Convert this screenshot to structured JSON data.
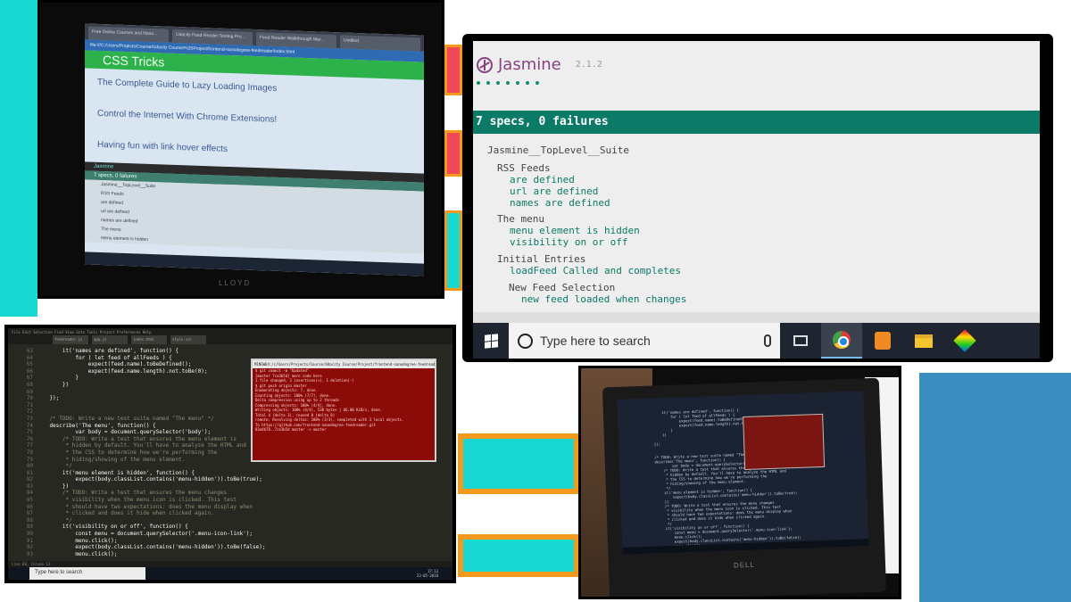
{
  "collage": {
    "accent_cyan": "#19d8d2",
    "accent_orange": "#f39a1e",
    "accent_red": "#f0475a",
    "accent_blue": "#3a8ec0"
  },
  "photo_monitor": {
    "tabs": [
      "Free Online Courses and Nano...",
      "Udacity Feed Reader Testing Pro...",
      "Feed Reader Walkthrough Mar...",
      "Untitled"
    ],
    "url": "file:///C:/Users/Projects/Course/Udacity Course/%20Project/frontend-nanodegree-feedreader/index.html",
    "header": "CSS Tricks",
    "links": [
      "The Complete Guide to Lazy Loading Images",
      "Control the Internet With Chrome Extensions!",
      "Having fun with link hover effects"
    ],
    "jasmine_label": "Jasmine",
    "jasmine_result": "7 specs, 0 failures",
    "specs": [
      "Jasmine__TopLevel__Suite",
      "RSS Feeds",
      "are defined",
      "url are defined",
      "names are defined",
      "The menu",
      "menu element is hidden"
    ],
    "bezel": "LLOYD"
  },
  "jasmine": {
    "name": "Jasmine",
    "version": "2.1.2",
    "dots": 7,
    "result": "7 specs, 0 failures",
    "top_suite": "Jasmine__TopLevel__Suite",
    "suites": [
      {
        "title": "RSS Feeds",
        "specs": [
          "are defined",
          "url are defined",
          "names are defined"
        ]
      },
      {
        "title": "The menu",
        "specs": [
          "menu element is hidden",
          "visibility on or off"
        ]
      },
      {
        "title": "Initial Entries",
        "specs": [
          "loadFeed Called and completes"
        ]
      },
      {
        "title": "New Feed Selection",
        "specs": [
          "new feed loaded when changes"
        ]
      }
    ],
    "taskbar": {
      "search_placeholder": "Type here to search",
      "icons": [
        "task-view-icon",
        "chrome-icon",
        "sublime-text-icon",
        "file-explorer-icon",
        "gitkraken-icon"
      ]
    }
  },
  "editor": {
    "menu": "File  Edit  Selection  Find  View  Goto  Tools  Project  Preferences  Help",
    "tabs": [
      "feedreader.js",
      "app.js",
      "index.html",
      "style.css"
    ],
    "lines": [
      {
        "n": "63",
        "t": "        it('names are defined', function() {"
      },
      {
        "n": "64",
        "t": "            for ( let feed of allFeeds ) {"
      },
      {
        "n": "65",
        "t": "                expect(feed.name).toBeDefined();"
      },
      {
        "n": "66",
        "t": "                expect(feed.name.length).not.toBe(0);"
      },
      {
        "n": "67",
        "t": "            }"
      },
      {
        "n": "68",
        "t": "        })"
      },
      {
        "n": "69",
        "t": ""
      },
      {
        "n": "70",
        "t": "    });"
      },
      {
        "n": "71",
        "t": ""
      },
      {
        "n": "72",
        "t": ""
      },
      {
        "n": "73",
        "t": "    /* TODO: Write a new test suite named \"The menu\" */",
        "c": true
      },
      {
        "n": "74",
        "t": "    describe('The menu', function() {"
      },
      {
        "n": "75",
        "t": "            var body = document.querySelector('body');"
      },
      {
        "n": "76",
        "t": "        /* TODO: Write a test that ensures the menu element is",
        "c": true
      },
      {
        "n": "77",
        "t": "         * hidden by default. You'll have to analyze the HTML and",
        "c": true
      },
      {
        "n": "78",
        "t": "         * the CSS to determine how we're performing the",
        "c": true
      },
      {
        "n": "79",
        "t": "         * hiding/showing of the menu element.",
        "c": true
      },
      {
        "n": "80",
        "t": "         */",
        "c": true
      },
      {
        "n": "81",
        "t": "        it('menu element is hidden', function() {"
      },
      {
        "n": "82",
        "t": "            expect(body.classList.contains('menu-hidden')).toBe(true);"
      },
      {
        "n": "83",
        "t": "        })"
      },
      {
        "n": "84",
        "t": "        /* TODO: Write a test that ensures the menu changes",
        "c": true
      },
      {
        "n": "85",
        "t": "         * visibility when the menu icon is clicked. This test",
        "c": true
      },
      {
        "n": "86",
        "t": "         * should have two expectations: does the menu display when",
        "c": true
      },
      {
        "n": "87",
        "t": "         * clicked and does it hide when clicked again.",
        "c": true
      },
      {
        "n": "88",
        "t": "         */",
        "c": true
      },
      {
        "n": "89",
        "t": "        it('visibility on or off', function() {"
      },
      {
        "n": "90",
        "t": "            const menu = document.querySelector('.menu-icon-link');"
      },
      {
        "n": "91",
        "t": "            menu.click();"
      },
      {
        "n": "92",
        "t": "            expect(body.classList.contains('menu-hidden')).toBe(false);"
      },
      {
        "n": "93",
        "t": "            menu.click();"
      }
    ],
    "terminal_title": "MINGW64:/c/Users/Projects/Course/Udacity Course/Project/frontend-nanodegree-feedreader",
    "terminal_lines": [
      "$ git commit -m \"Updated\"",
      "[master 7ce3b5d] more code here",
      " 1 file changed, 3 insertions(+), 1 deletion(-)",
      "",
      "$ git push origin master",
      "Enumerating objects: 7, done.",
      "Counting objects: 100% (7/7), done.",
      "Delta compression using up to 2 threads",
      "Compressing objects: 100% (4/4), done.",
      "Writing objects: 100% (4/4), 530 bytes | 66.00 KiB/s, done.",
      "Total 4 (delta 3), reused 0 (delta 0)",
      "remote: Resolving deltas: 100% (3/3), completed with 3 local objects.",
      "To https://github.com/frontend-nanodegree-feedreader.git",
      "   83a4b78..7ce3b5d  master -> master"
    ],
    "status": "Line 68, Column 13",
    "taskbar_search": "Type here to search",
    "clock": "17:13",
    "date": "23-05-2018"
  },
  "photo_laptop": {
    "brand": "DELL"
  }
}
